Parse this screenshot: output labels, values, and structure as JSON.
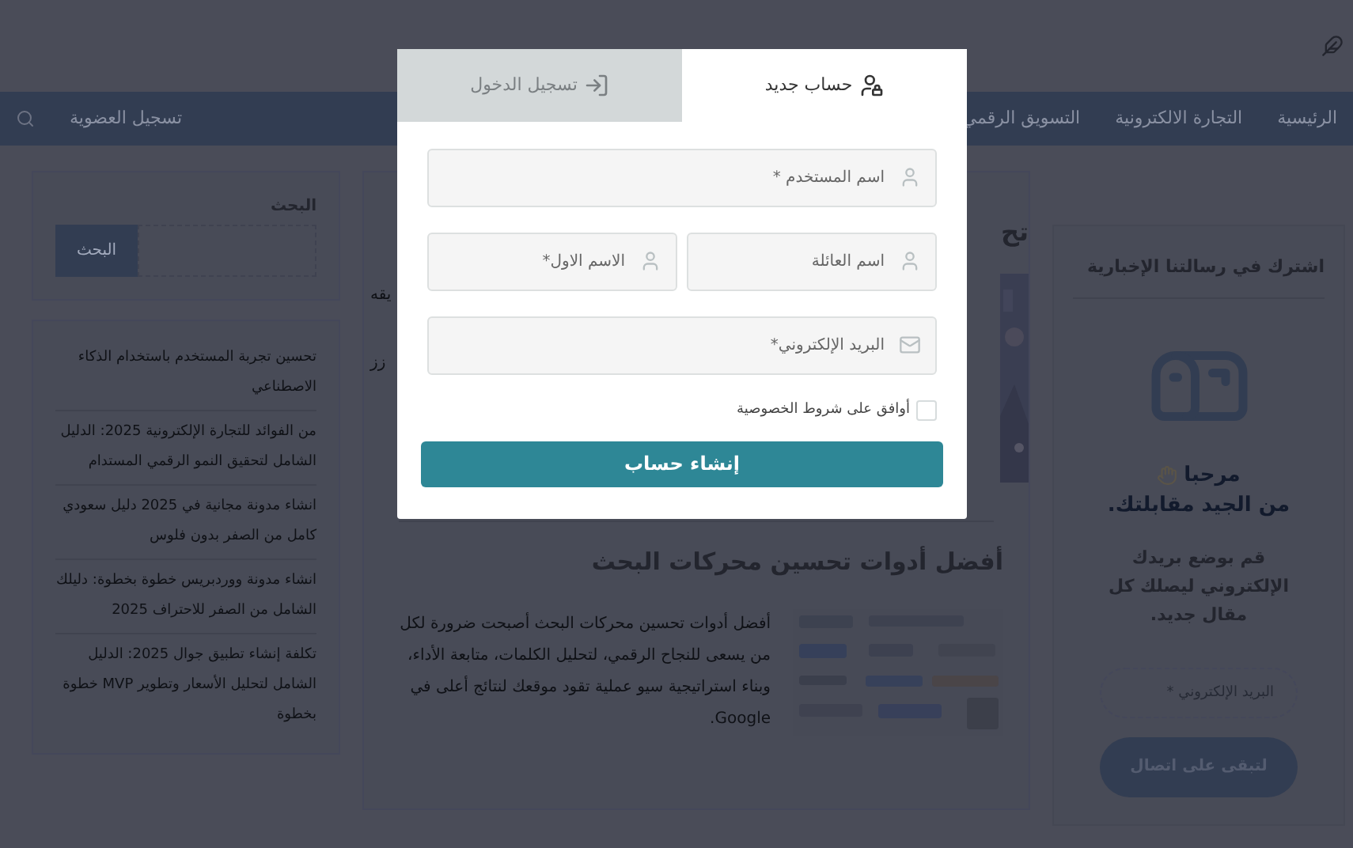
{
  "nav": {
    "items": [
      "الرئيسية",
      "التجارة الالكترونية",
      "التسويق الرقمي",
      "تسجيل العضوية"
    ]
  },
  "newsletter": {
    "title": "اشترك في رسالتنا الإخبارية",
    "greeting": "مرحبا",
    "subtitle": "من الجيد مقابلتك.",
    "text": "قم بوضع بريدك الإلكتروني ليصلك كل مقال جديد.",
    "email_placeholder": "البريد الإلكتروني *",
    "button": "لتبقى على اتصال"
  },
  "article_top": {
    "title_fragment": "تح",
    "text_fragments": [
      "يقه",
      "زز"
    ]
  },
  "article": {
    "title": "أفضل أدوات تحسين محركات البحث",
    "body": "أفضل أدوات تحسين محركات البحث أصبحت ضرورة لكل من يسعى للنجاح الرقمي، لتحليل الكلمات، متابعة الأداء، وبناء استراتيجية سيو عملية تقود موقعك لنتائج أعلى في Google."
  },
  "sidebar": {
    "search": {
      "title": "البحث",
      "button": "البحث"
    },
    "posts": [
      "تحسين تجربة المستخدم باستخدام الذكاء الاصطناعي",
      "من الفوائد للتجارة الإلكترونية 2025: الدليل الشامل لتحقيق النمو الرقمي المستدام",
      "انشاء مدونة مجانية في 2025 دليل سعودي كامل من الصفر بدون فلوس",
      "انشاء مدونة ووردبريس خطوة بخطوة: دليلك الشامل من الصفر للاحتراف 2025",
      "تكلفة إنشاء تطبيق جوال 2025: الدليل الشامل لتحليل الأسعار وتطوير MVP خطوة بخطوة"
    ]
  },
  "modal": {
    "tabs": [
      {
        "label": "حساب جديد",
        "kind": "register",
        "selected": true
      },
      {
        "label": "تسجيل الدخول",
        "kind": "login",
        "selected": false
      }
    ],
    "rows": [
      [
        {
          "placeholder": "اسم المستخدم *",
          "kind": "user"
        }
      ],
      [
        {
          "placeholder": "اسم العائلة",
          "kind": "user"
        },
        {
          "placeholder": "الاسم الاول*",
          "kind": "user"
        }
      ],
      [
        {
          "placeholder": "البريد الإلكتروني*",
          "kind": "mail"
        }
      ]
    ],
    "agree": {
      "label": "أوافق على شروط الخصوصية",
      "checked": false
    },
    "submit": "إنشاء حساب"
  }
}
